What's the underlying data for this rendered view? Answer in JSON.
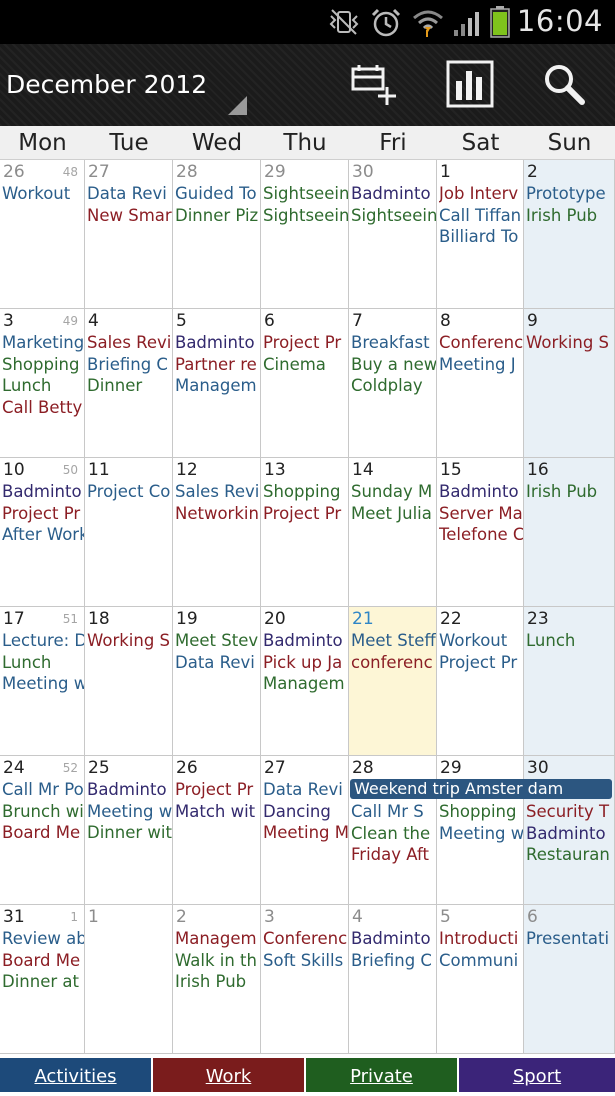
{
  "status_bar": {
    "time": "16:04",
    "icons": [
      "mute-vibrate-icon",
      "alarm-icon",
      "wifi-icon",
      "signal-icon",
      "battery-icon"
    ]
  },
  "action_bar": {
    "title": "December 2012",
    "buttons": [
      "new-event-icon",
      "chart-view-icon",
      "search-icon"
    ]
  },
  "weekdays": [
    "Mon",
    "Tue",
    "Wed",
    "Thu",
    "Fri",
    "Sat",
    "Sun"
  ],
  "colors": {
    "activities": "#1d4a7a",
    "work": "#7a1c1c",
    "private": "#1f5e1f",
    "sport": "#3b2479",
    "today_bg": "#fdf6d6",
    "sunday_bg": "#e8f0f6",
    "span_event": "#2c5680"
  },
  "weeks": [
    {
      "week_number": "48",
      "days": [
        {
          "day": "26",
          "other": true,
          "events": [
            {
              "t": "Workout",
              "c": "blue"
            }
          ]
        },
        {
          "day": "27",
          "other": true,
          "events": [
            {
              "t": "Data Revi",
              "c": "blue"
            },
            {
              "t": "New Smar",
              "c": "red"
            }
          ]
        },
        {
          "day": "28",
          "other": true,
          "events": [
            {
              "t": "Guided To",
              "c": "blue"
            },
            {
              "t": "Dinner Piz",
              "c": "green"
            }
          ]
        },
        {
          "day": "29",
          "other": true,
          "events": [
            {
              "t": "Sightseein",
              "c": "green"
            },
            {
              "t": "Sightseein",
              "c": "green"
            }
          ]
        },
        {
          "day": "30",
          "other": true,
          "events": [
            {
              "t": "Badminto",
              "c": "navy"
            },
            {
              "t": "Sightseein",
              "c": "green"
            }
          ]
        },
        {
          "day": "1",
          "events": [
            {
              "t": "Job Interv",
              "c": "red"
            },
            {
              "t": "Call Tiffan",
              "c": "blue"
            },
            {
              "t": "Billiard To",
              "c": "blue"
            }
          ]
        },
        {
          "day": "2",
          "events": [
            {
              "t": "Prototype",
              "c": "blue"
            },
            {
              "t": "Irish Pub",
              "c": "green"
            }
          ]
        }
      ]
    },
    {
      "week_number": "49",
      "days": [
        {
          "day": "3",
          "events": [
            {
              "t": "Marketing",
              "c": "blue"
            },
            {
              "t": "Shopping",
              "c": "green"
            },
            {
              "t": "Lunch",
              "c": "green"
            },
            {
              "t": "Call Betty",
              "c": "red"
            }
          ]
        },
        {
          "day": "4",
          "events": [
            {
              "t": "Sales Revi",
              "c": "red"
            },
            {
              "t": "Briefing C",
              "c": "blue"
            },
            {
              "t": "Dinner",
              "c": "green"
            }
          ]
        },
        {
          "day": "5",
          "events": [
            {
              "t": "Badminto",
              "c": "navy"
            },
            {
              "t": "Partner re",
              "c": "red"
            },
            {
              "t": "Managem",
              "c": "blue"
            }
          ]
        },
        {
          "day": "6",
          "events": [
            {
              "t": "Project Pr",
              "c": "red"
            },
            {
              "t": "Cinema",
              "c": "green"
            }
          ]
        },
        {
          "day": "7",
          "events": [
            {
              "t": "Breakfast",
              "c": "blue"
            },
            {
              "t": "Buy a new",
              "c": "green"
            },
            {
              "t": "Coldplay",
              "c": "green"
            }
          ]
        },
        {
          "day": "8",
          "events": [
            {
              "t": "Conferenc",
              "c": "red"
            },
            {
              "t": "Meeting J",
              "c": "blue"
            }
          ]
        },
        {
          "day": "9",
          "events": [
            {
              "t": "Working S",
              "c": "red"
            }
          ]
        }
      ]
    },
    {
      "week_number": "50",
      "days": [
        {
          "day": "10",
          "events": [
            {
              "t": "Badminto",
              "c": "navy"
            },
            {
              "t": "Project Pr",
              "c": "red"
            },
            {
              "t": "After Work",
              "c": "blue"
            }
          ]
        },
        {
          "day": "11",
          "events": [
            {
              "t": "Project Co",
              "c": "blue"
            }
          ]
        },
        {
          "day": "12",
          "events": [
            {
              "t": "Sales Revi",
              "c": "blue"
            },
            {
              "t": "Networkin",
              "c": "red"
            }
          ]
        },
        {
          "day": "13",
          "events": [
            {
              "t": "Shopping",
              "c": "green"
            },
            {
              "t": "Project Pr",
              "c": "red"
            }
          ]
        },
        {
          "day": "14",
          "events": [
            {
              "t": "Sunday M",
              "c": "green"
            },
            {
              "t": "Meet Julia",
              "c": "green"
            }
          ]
        },
        {
          "day": "15",
          "events": [
            {
              "t": "Badminto",
              "c": "navy"
            },
            {
              "t": "Server Ma",
              "c": "red"
            },
            {
              "t": "Telefone C",
              "c": "red"
            }
          ]
        },
        {
          "day": "16",
          "events": [
            {
              "t": "Irish Pub",
              "c": "green"
            }
          ]
        }
      ]
    },
    {
      "week_number": "51",
      "days": [
        {
          "day": "17",
          "events": [
            {
              "t": "Lecture: D",
              "c": "blue"
            },
            {
              "t": "Lunch",
              "c": "green"
            },
            {
              "t": "Meeting w",
              "c": "blue"
            }
          ]
        },
        {
          "day": "18",
          "events": [
            {
              "t": "Working S",
              "c": "red"
            }
          ]
        },
        {
          "day": "19",
          "events": [
            {
              "t": "Meet Stev",
              "c": "green"
            },
            {
              "t": "Data Revi",
              "c": "blue"
            }
          ]
        },
        {
          "day": "20",
          "events": [
            {
              "t": "Badminto",
              "c": "navy"
            },
            {
              "t": "Pick up Ja",
              "c": "red"
            },
            {
              "t": "Managem",
              "c": "green"
            }
          ]
        },
        {
          "day": "21",
          "today": true,
          "events": [
            {
              "t": "Meet Steff",
              "c": "blue"
            },
            {
              "t": "conferenc",
              "c": "red"
            }
          ]
        },
        {
          "day": "22",
          "events": [
            {
              "t": "Workout",
              "c": "blue"
            },
            {
              "t": "Project Pr",
              "c": "blue"
            }
          ]
        },
        {
          "day": "23",
          "events": [
            {
              "t": "Lunch",
              "c": "green"
            }
          ]
        }
      ]
    },
    {
      "week_number": "52",
      "span_event": {
        "t": "Weekend trip Amster dam"
      },
      "days": [
        {
          "day": "24",
          "events": [
            {
              "t": "Call Mr Po",
              "c": "blue"
            },
            {
              "t": "Brunch wi",
              "c": "green"
            },
            {
              "t": "Board Me",
              "c": "red"
            }
          ]
        },
        {
          "day": "25",
          "events": [
            {
              "t": "Badminto",
              "c": "navy"
            },
            {
              "t": "Meeting w",
              "c": "blue"
            },
            {
              "t": "Dinner wit",
              "c": "green"
            }
          ]
        },
        {
          "day": "26",
          "events": [
            {
              "t": "Project Pr",
              "c": "red"
            },
            {
              "t": "Match wit",
              "c": "navy"
            }
          ]
        },
        {
          "day": "27",
          "events": [
            {
              "t": "Data Revi",
              "c": "blue"
            },
            {
              "t": "Dancing",
              "c": "navy"
            },
            {
              "t": "Meeting M",
              "c": "red"
            }
          ]
        },
        {
          "day": "28",
          "offset": true,
          "events": [
            {
              "t": "Call Mr S",
              "c": "blue"
            },
            {
              "t": "Clean the",
              "c": "green"
            },
            {
              "t": "Friday Aft",
              "c": "red"
            }
          ]
        },
        {
          "day": "29",
          "offset": true,
          "events": [
            {
              "t": "Shopping",
              "c": "green"
            },
            {
              "t": "Meeting w",
              "c": "blue"
            }
          ]
        },
        {
          "day": "30",
          "offset": true,
          "events": [
            {
              "t": "Security T",
              "c": "red"
            },
            {
              "t": "Badminto",
              "c": "navy"
            },
            {
              "t": "Restauran",
              "c": "green"
            }
          ]
        }
      ]
    },
    {
      "week_number": "1",
      "days": [
        {
          "day": "31",
          "events": [
            {
              "t": "Review ab",
              "c": "blue"
            },
            {
              "t": "Board Me",
              "c": "red"
            },
            {
              "t": "Dinner at",
              "c": "green"
            }
          ]
        },
        {
          "day": "1",
          "other": true,
          "events": []
        },
        {
          "day": "2",
          "other": true,
          "events": [
            {
              "t": "Managem",
              "c": "red"
            },
            {
              "t": "Walk in th",
              "c": "green"
            },
            {
              "t": "Irish Pub",
              "c": "green"
            }
          ]
        },
        {
          "day": "3",
          "other": true,
          "events": [
            {
              "t": "Conferenc",
              "c": "red"
            },
            {
              "t": "Soft Skills",
              "c": "blue"
            }
          ]
        },
        {
          "day": "4",
          "other": true,
          "events": [
            {
              "t": "Badminto",
              "c": "navy"
            },
            {
              "t": "Briefing C",
              "c": "blue"
            }
          ]
        },
        {
          "day": "5",
          "other": true,
          "events": [
            {
              "t": "Introducti",
              "c": "red"
            },
            {
              "t": "Communi",
              "c": "blue"
            }
          ]
        },
        {
          "day": "6",
          "other": true,
          "events": [
            {
              "t": "Presentati",
              "c": "blue"
            }
          ]
        }
      ]
    }
  ],
  "tabs": [
    {
      "label": "Activities",
      "color": "#1d4a7a"
    },
    {
      "label": "Work",
      "color": "#7a1c1c"
    },
    {
      "label": "Private",
      "color": "#1f5e1f"
    },
    {
      "label": "Sport",
      "color": "#3b2479"
    }
  ]
}
